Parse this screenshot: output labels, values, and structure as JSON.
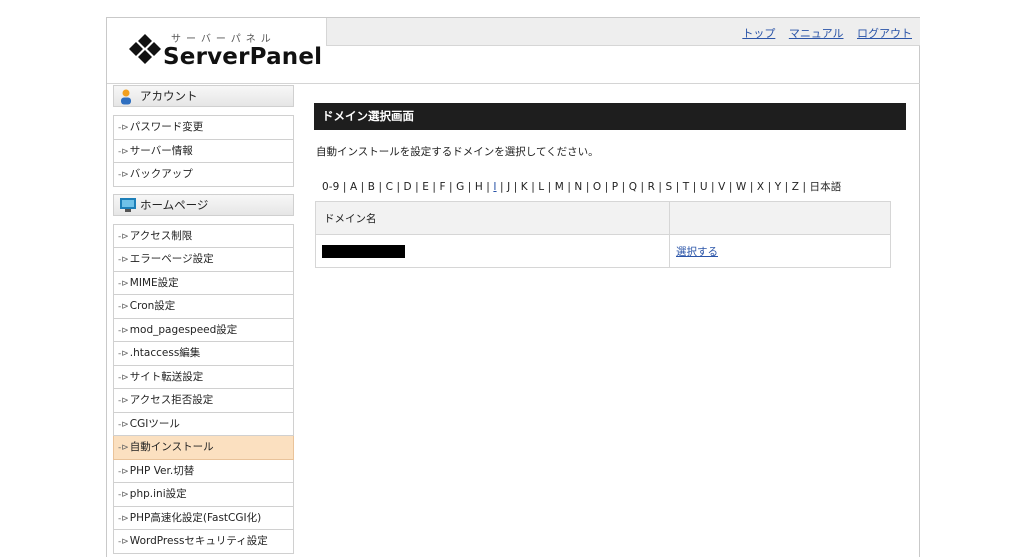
{
  "header": {
    "logo_kana": "サーバーパネル",
    "logo_text": "ServerPanel",
    "links": [
      "トップ",
      "マニュアル",
      "ログアウト"
    ]
  },
  "sidebar": {
    "account": {
      "title": "アカウント",
      "items": [
        "パスワード変更",
        "サーバー情報",
        "バックアップ"
      ]
    },
    "homepage": {
      "title": "ホームページ",
      "items": [
        "アクセス制限",
        "エラーページ設定",
        "MIME設定",
        "Cron設定",
        "mod_pagespeed設定",
        ".htaccess編集",
        "サイト転送設定",
        "アクセス拒否設定",
        "CGIツール",
        "自動インストール",
        "PHP Ver.切替",
        "php.ini設定",
        "PHP高速化設定(FastCGI化)",
        "WordPressセキュリティ設定"
      ],
      "active": "自動インストール"
    }
  },
  "main": {
    "title": "ドメイン選択画面",
    "description": "自動インストールを設定するドメインを選択してください。",
    "alpha_before": "0-9 | A | B | C | D | E | F | G | H | ",
    "alpha_current": "I",
    "alpha_after": " | J | K | L | M | N | O | P | Q | R | S | T | U | V | W | X | Y | Z | 日本語",
    "table": {
      "headers": [
        "ドメイン名",
        ""
      ],
      "rows": [
        {
          "domain": "",
          "action": "選択する"
        }
      ]
    }
  },
  "colors": {
    "title_bar": "#1e1e1e",
    "active_item": "#fbe0c0",
    "link": "#2a54a8"
  }
}
